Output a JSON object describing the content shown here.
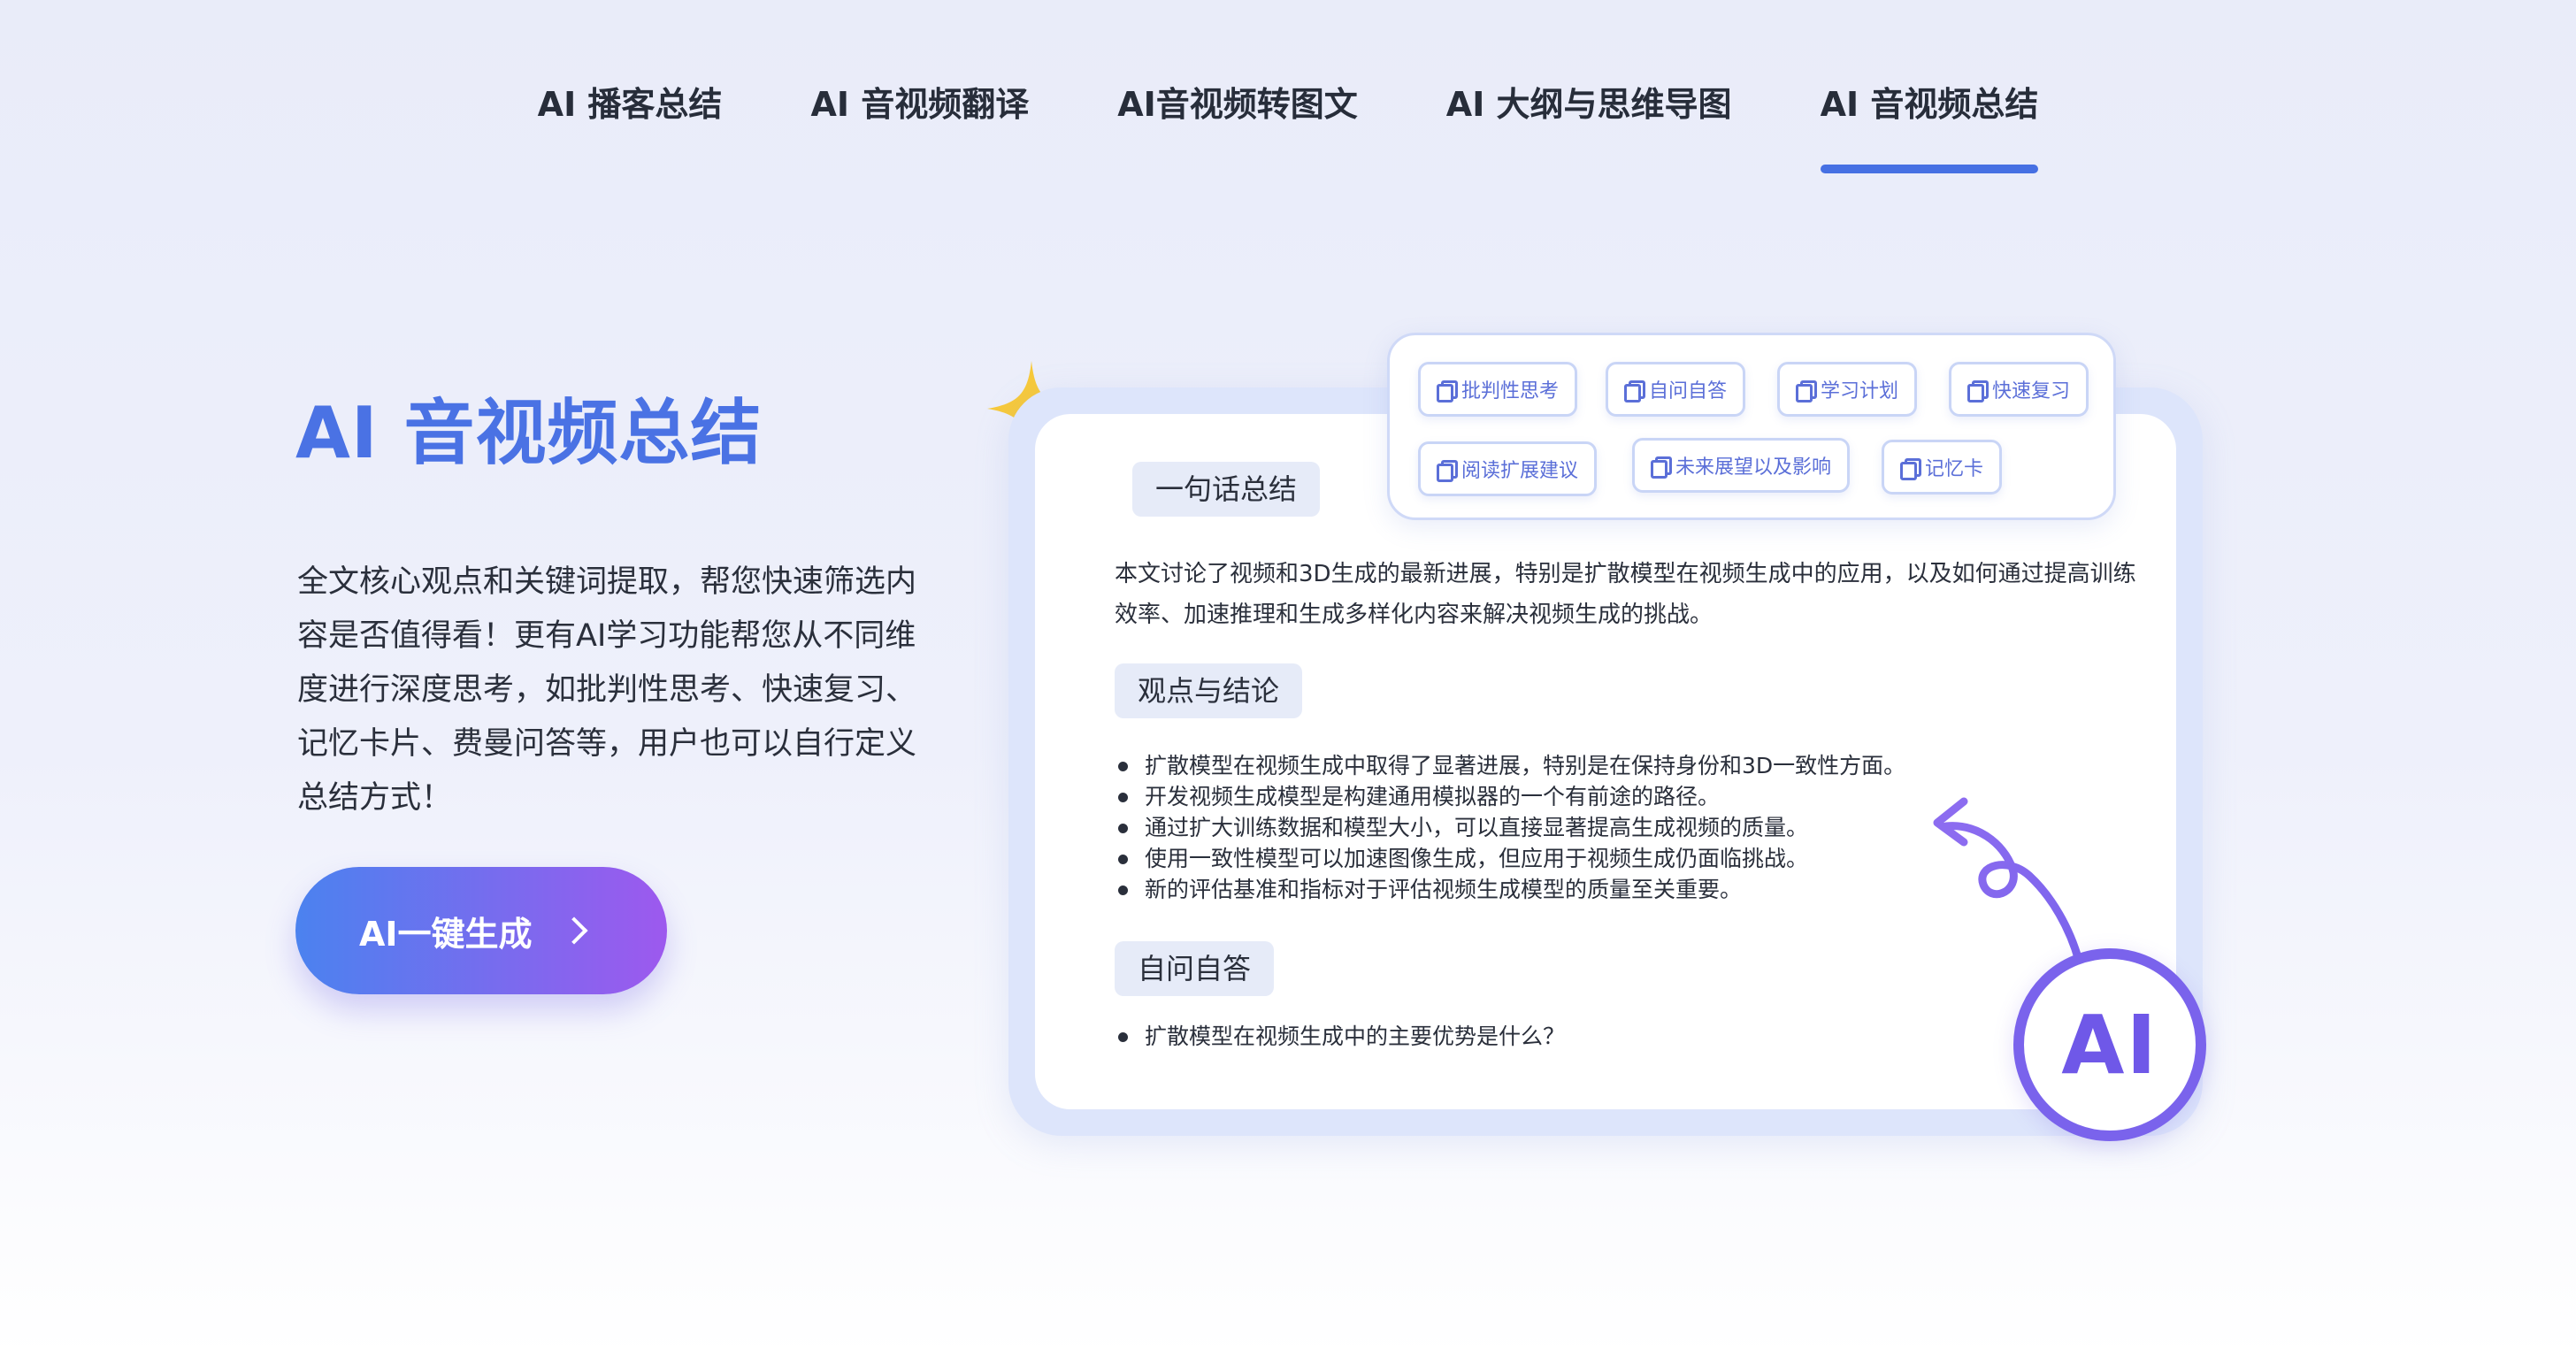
{
  "tabs": [
    {
      "label": "AI 播客总结",
      "active": false
    },
    {
      "label": "AI 音视频翻译",
      "active": false
    },
    {
      "label": "AI音视频转图文",
      "active": false
    },
    {
      "label": "AI 大纲与思维导图",
      "active": false
    },
    {
      "label": "AI 音视频总结",
      "active": true
    }
  ],
  "hero": {
    "title": "AI 音视频总结",
    "description": "全文核心观点和关键词提取，帮您快速筛选内容是否值得看！更有AI学习功能帮您从不同维度进行深度思考，如批判性思考、快速复习、记忆卡片、费曼问答等，用户也可以自行定义总结方式！",
    "cta_label": "AI一键生成"
  },
  "tags": [
    {
      "label": "批判性思考",
      "icon": "copy-icon"
    },
    {
      "label": "自问自答",
      "icon": "copy-icon"
    },
    {
      "label": "学习计划",
      "icon": "copy-icon"
    },
    {
      "label": "快速复习",
      "icon": "copy-icon"
    },
    {
      "label": "阅读扩展建议",
      "icon": "copy-icon"
    },
    {
      "label": "未来展望以及影响",
      "icon": "copy-icon"
    },
    {
      "label": "记忆卡",
      "icon": "copy-icon"
    }
  ],
  "card": {
    "section1_title": "一句话总结",
    "section1_text": "本文讨论了视频和3D生成的最新进展，特别是扩散模型在视频生成中的应用，以及如何通过提高训练效率、加速推理和生成多样化内容来解决视频生成的挑战。",
    "section2_title": "观点与结论",
    "section2_points": [
      "扩散模型在视频生成中取得了显著进展，特别是在保持身份和3D一致性方面。",
      "开发视频生成模型是构建通用模拟器的一个有前途的路径。",
      "通过扩大训练数据和模型大小，可以直接显著提高生成视频的质量。",
      "使用一致性模型可以加速图像生成，但应用于视频生成仍面临挑战。",
      "新的评估基准和指标对于评估视频生成模型的质量至关重要。"
    ],
    "section3_title": "自问自答",
    "section3_points": [
      "扩散模型在视频生成中的主要优势是什么？"
    ]
  },
  "badge": {
    "text": "AI"
  },
  "colors": {
    "accent_blue": "#4670e3",
    "title_blue": "#4a72e4",
    "gradient_start": "#4b82ef",
    "gradient_end": "#9d59ee",
    "badge_purple": "#7a63ec",
    "sparkle_yellow": "#f7c93a"
  }
}
